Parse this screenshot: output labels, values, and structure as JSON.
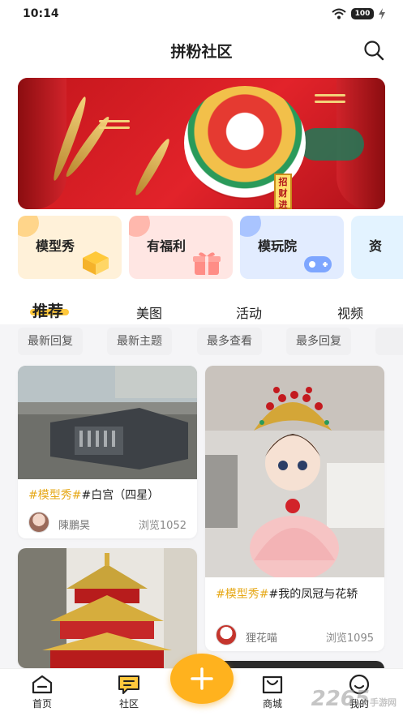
{
  "status_bar": {
    "time": "10:14",
    "battery": "100"
  },
  "header": {
    "title": "拼粉社区"
  },
  "banner": {
    "sign_text": "招财进"
  },
  "categories": [
    {
      "label": "模型秀",
      "color": "#fff1d9",
      "blob": "#ffd58a",
      "icon": "box-icon"
    },
    {
      "label": "有福利",
      "color": "#ffe6e3",
      "blob": "#ffb8ad",
      "icon": "gift-icon"
    },
    {
      "label": "模玩院",
      "color": "#e2ecff",
      "blob": "#a9c4ff",
      "icon": "gamepad-icon"
    },
    {
      "label": "资"
    }
  ],
  "tabs": [
    {
      "label": "推荐",
      "active": true
    },
    {
      "label": "美图"
    },
    {
      "label": "活动"
    },
    {
      "label": "视频"
    }
  ],
  "filters": [
    "最新回复",
    "最新主题",
    "最多查看",
    "最多回复"
  ],
  "posts": [
    {
      "topic": "#模型秀#",
      "title": "#白宫（四星）",
      "author": "陳鵬昊",
      "views": "浏览1052"
    },
    {
      "topic": "#模型秀#",
      "title": "#我的凤冠与花轿",
      "author": "狸花喵",
      "views": "浏览1095"
    },
    {
      "topic": "",
      "title": "",
      "author": "",
      "views": ""
    }
  ],
  "nav": [
    {
      "label": "首页",
      "icon": "home-icon"
    },
    {
      "label": "社区",
      "icon": "community-icon"
    },
    {
      "label": "商城",
      "icon": "shop-icon"
    },
    {
      "label": "我的",
      "icon": "profile-icon"
    }
  ],
  "watermark": {
    "main": "2265",
    "sub": "手游网"
  },
  "colors": {
    "accent": "#ffb21e",
    "topic": "#e6a817"
  }
}
